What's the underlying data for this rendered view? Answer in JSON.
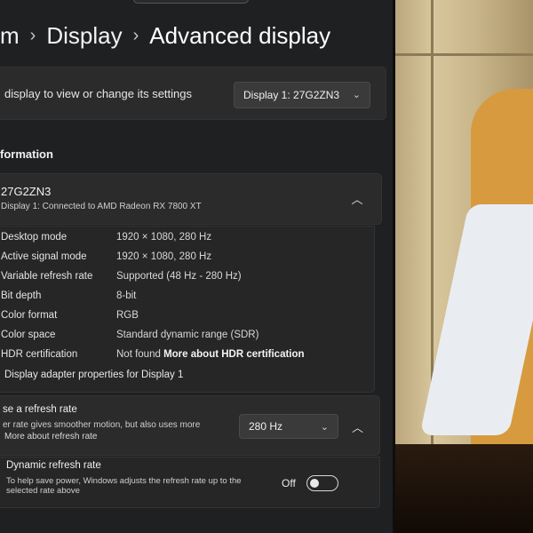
{
  "breadcrumb": {
    "items": [
      "m",
      "Display",
      "Advanced display"
    ],
    "separator": "›"
  },
  "select_display": {
    "label": "display to view or change its settings",
    "dropdown_value": "Display 1: 27G2ZN3"
  },
  "section_heading": "formation",
  "monitor": {
    "name": "27G2ZN3",
    "subtitle": "Display 1: Connected to AMD Radeon RX 7800 XT"
  },
  "info_rows": [
    {
      "key": "Desktop mode",
      "value": "1920 × 1080, 280 Hz"
    },
    {
      "key": "Active signal mode",
      "value": "1920 × 1080, 280 Hz"
    },
    {
      "key": "Variable refresh rate",
      "value": "Supported (48 Hz - 280 Hz)"
    },
    {
      "key": "Bit depth",
      "value": "8-bit"
    },
    {
      "key": "Color format",
      "value": "RGB"
    },
    {
      "key": "Color space",
      "value": "Standard dynamic range (SDR)"
    },
    {
      "key": "HDR certification",
      "value": "Not found",
      "link": "More about HDR certification"
    }
  ],
  "adapter_link": "Display adapter properties for Display 1",
  "refresh": {
    "title": "se a refresh rate",
    "description": "er rate gives smoother motion, but also uses more",
    "link": "More about refresh rate",
    "value": "280 Hz"
  },
  "dynamic": {
    "title": "Dynamic refresh rate",
    "description": "To help save power, Windows adjusts the refresh rate up to the selected rate above",
    "state_label": "Off"
  },
  "icons": {
    "chevron_down": "chevron-down-icon",
    "chevron_up": "chevron-up-icon"
  },
  "colors": {
    "panel": "#1f2021",
    "card": "#2b2b2c",
    "text": "#e8e8e8"
  }
}
